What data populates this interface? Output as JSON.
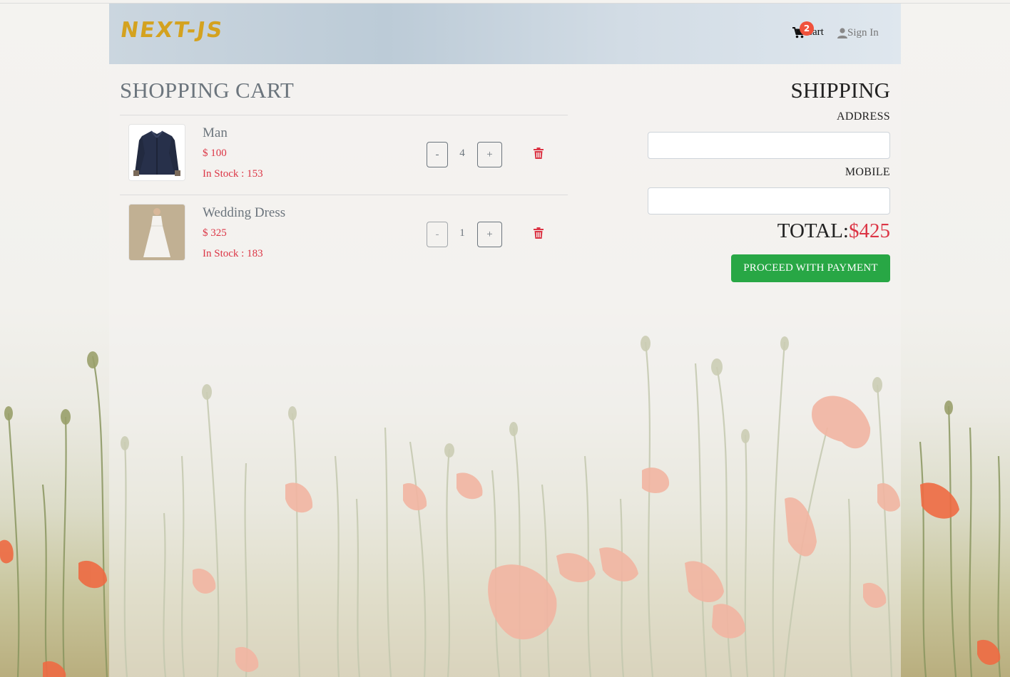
{
  "header": {
    "brand": "NEXT-JS",
    "cart_label": "Cart",
    "cart_count": "2",
    "signin_label": "Sign In"
  },
  "cart": {
    "title": "SHOPPING CART",
    "items": [
      {
        "name": "Man",
        "price": "$ 100",
        "stock": "In Stock : 153",
        "quantity": "4",
        "minus_label": "-",
        "plus_label": "+"
      },
      {
        "name": "Wedding Dress",
        "price": "$ 325",
        "stock": "In Stock : 183",
        "quantity": "1",
        "minus_label": "-",
        "plus_label": "+"
      }
    ]
  },
  "shipping": {
    "title": "SHIPPING",
    "address_label": "ADDRESS",
    "address_value": "",
    "mobile_label": "MOBILE",
    "mobile_value": "",
    "total_label": "TOTAL:",
    "total_value": "$425",
    "pay_label": "PROCEED WITH PAYMENT"
  },
  "icons": {
    "cart": "cart-icon",
    "user": "user-icon",
    "trash": "trash-icon"
  },
  "colors": {
    "brand": "#d4a21f",
    "price": "#dc3545",
    "badge": "#f0523c",
    "pay_button": "#28a745"
  }
}
